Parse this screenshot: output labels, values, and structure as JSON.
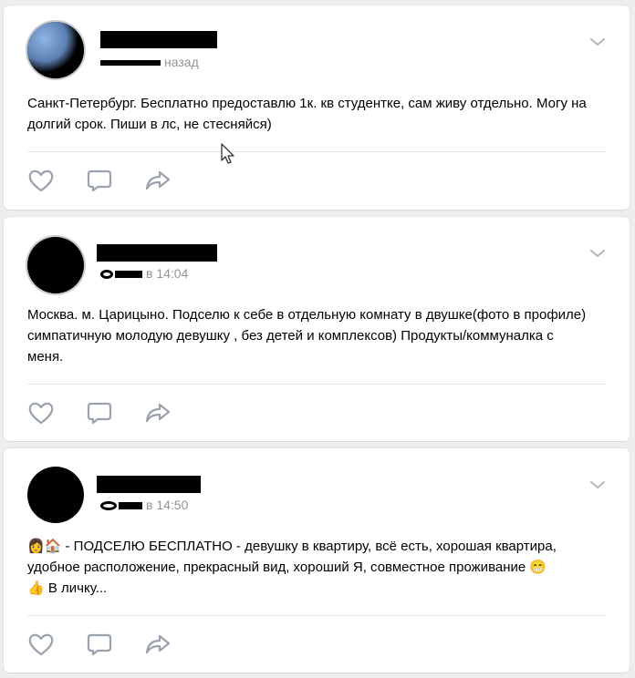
{
  "posts": [
    {
      "time_suffix": "назад",
      "text": "Санкт-Петербург. Бесплатно предоставлю 1к. кв студентке, сам живу отдельно. Могу на долгий срок. Пиши в лс, не стесняйся)"
    },
    {
      "time": "в 14:04",
      "text": "Москва. м. Царицыно. Подселю к себе в отдельную комнату в двушке(фото в профиле) симпатичную молодую девушку , без детей и комплексов) Продукты/коммуналка с меня."
    },
    {
      "time": "в 14:50",
      "text_line1": "👩🏠 - ПОДСЕЛЮ БЕСПЛАТНО - девушку в квартиру, всё есть, хорошая квартира,",
      "text_line2": "удобное расположение, прекрасный вид, хороший Я, совместное проживание 😁",
      "text_line3": "👍 В личку..."
    }
  ],
  "icons": {
    "like": "heart-icon",
    "comment": "comment-icon",
    "share": "share-icon",
    "menu": "chevron-down-icon"
  },
  "colors": {
    "background": "#edeef0",
    "card": "#ffffff",
    "icon": "#99a2ad",
    "meta_text": "#939393"
  }
}
